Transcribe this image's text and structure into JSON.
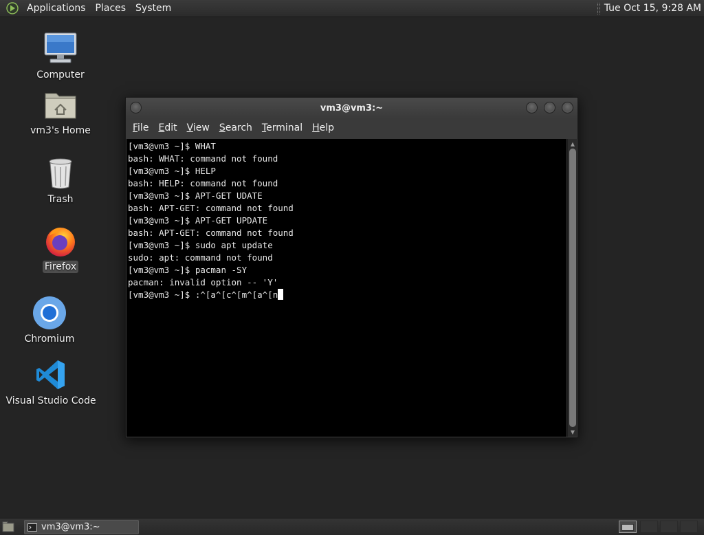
{
  "top_panel": {
    "menus": [
      "Applications",
      "Places",
      "System"
    ],
    "clock": "Tue Oct 15,  9:28 AM"
  },
  "desktop": {
    "icons": [
      {
        "label": "Computer",
        "icon": "computer-icon"
      },
      {
        "label": "vm3's Home",
        "icon": "home-folder-icon"
      },
      {
        "label": "Trash",
        "icon": "trash-icon"
      },
      {
        "label": "Firefox",
        "icon": "firefox-icon",
        "selected": true
      },
      {
        "label": "Chromium",
        "icon": "chromium-icon"
      },
      {
        "label": "Visual Studio Code",
        "icon": "vscode-icon"
      }
    ]
  },
  "terminal": {
    "title": "vm3@vm3:~",
    "menu": [
      {
        "label": "File",
        "mnemonic": "F"
      },
      {
        "label": "Edit",
        "mnemonic": "E"
      },
      {
        "label": "View",
        "mnemonic": "V"
      },
      {
        "label": "Search",
        "mnemonic": "S"
      },
      {
        "label": "Terminal",
        "mnemonic": "T"
      },
      {
        "label": "Help",
        "mnemonic": "H"
      }
    ],
    "lines": [
      "[vm3@vm3 ~]$ WHAT",
      "bash: WHAT: command not found",
      "[vm3@vm3 ~]$ HELP",
      "bash: HELP: command not found",
      "[vm3@vm3 ~]$ APT-GET UDATE",
      "bash: APT-GET: command not found",
      "[vm3@vm3 ~]$ APT-GET UPDATE",
      "bash: APT-GET: command not found",
      "[vm3@vm3 ~]$ sudo apt update",
      "sudo: apt: command not found",
      "[vm3@vm3 ~]$ pacman -SY",
      "pacman: invalid option -- 'Y'"
    ],
    "current_line": "[vm3@vm3 ~]$ :^[a^[c^[m^[a^[n"
  },
  "taskbar": {
    "tasks": [
      {
        "label": "vm3@vm3:~",
        "icon": "terminal-icon"
      }
    ]
  },
  "colors": {
    "desktop_bg": "#242424",
    "terminal_bg": "#000000",
    "terminal_fg": "#e8e8e8"
  }
}
